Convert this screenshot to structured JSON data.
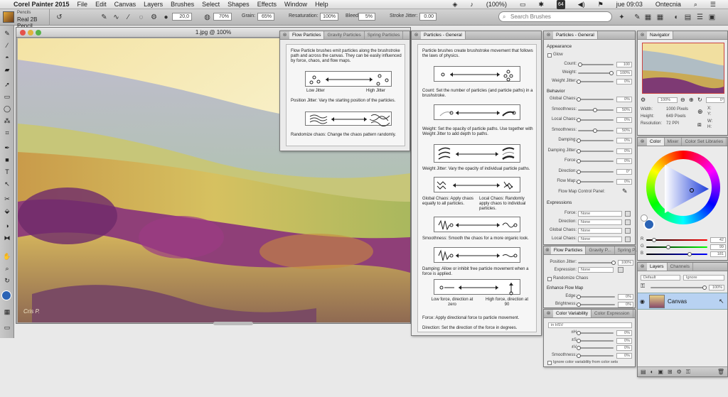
{
  "menubar": {
    "app": "Corel Painter 2015",
    "items": [
      "File",
      "Edit",
      "Canvas",
      "Layers",
      "Brushes",
      "Select",
      "Shapes",
      "Effects",
      "Window",
      "Help"
    ],
    "battery": "(100%)",
    "day_time": "jue 09:03",
    "user": "Ontecnia",
    "wifi_badge": "64"
  },
  "brush": {
    "category": "Pencils",
    "variant": "Real 2B Pencil"
  },
  "propbar": {
    "size": "20,0",
    "opacity": "70%",
    "grain_label": "Grain:",
    "grain": "65%",
    "resat_label": "Resaturation:",
    "resat": "100%",
    "bleed_label": "Bleed:",
    "bleed": "5%",
    "jitter_label": "Stroke Jitter:",
    "jitter": "0.00",
    "search_placeholder": "Search Brushes"
  },
  "canvas": {
    "title": "1.jpg @ 100%",
    "signature": "Cris P."
  },
  "flow_panel": {
    "tabs": [
      "Flow Particles",
      "Gravity Particles",
      "Spring Particles"
    ],
    "intro": "Flow Particle brushes emit particles along the brushstroke path and across the canvas. They can be easily influenced by force, chaos, and flow maps.",
    "low": "Low Jitter",
    "high": "High Jitter",
    "posjitter": "Position Jitter: Vary the starting position of the particles.",
    "randomize": "Randomize chaos: Change the chaos pattern randomly."
  },
  "general_help": {
    "tab": "Particles - General",
    "intro": "Particle brushes create brushstroke movement that follows the laws of physics.",
    "count": "Count: Set the number of particles (and particle paths) in a brushstroke.",
    "weight": "Weight: Set the opacity of particle paths. Use together with Weight Jitter to add depth to paths.",
    "wjitter": "Weight Jitter: Vary the opacity of individual particle paths.",
    "gchaos": "Global Chaos: Apply chaos equally to all particles.",
    "lchaos": "Local Chaos: Randomly apply chaos to individual particles.",
    "smooth": "Smoothness: Smooth the chaos for a more organic look.",
    "damping": "Damping: Allow or inhibit free particle movement when a force is applied.",
    "lowforce": "Low force, direction at zero",
    "highforce": "High force, direction at 90",
    "force": "Force: Apply directional force to particle movement.",
    "direction": "Direction: Set the direction of the force in degrees."
  },
  "gen_panel": {
    "tab": "Particles - General",
    "appearance": "Appearance",
    "glow": "Glow",
    "rows1": [
      {
        "label": "Count:",
        "value": "100"
      },
      {
        "label": "Weight:",
        "value": "100%"
      },
      {
        "label": "Weight Jitter:",
        "value": "0%"
      }
    ],
    "behavior": "Behavior",
    "rows2": [
      {
        "label": "Global Chaos:",
        "value": "0%"
      },
      {
        "label": "Smoothness:",
        "value": "50%"
      },
      {
        "label": "Local Chaos:",
        "value": "0%"
      },
      {
        "label": "Smoothness:",
        "value": "50%"
      },
      {
        "label": "Damping:",
        "value": "0%"
      },
      {
        "label": "Damping Jitter:",
        "value": "0%"
      },
      {
        "label": "Force:",
        "value": "0%"
      },
      {
        "label": "Direction:",
        "value": "0°"
      },
      {
        "label": "Flow Map:",
        "value": "0%"
      }
    ],
    "flowmap_panel": "Flow Map Control Panel:",
    "expressions": "Expressions",
    "rows3": [
      {
        "label": "Force:",
        "value": "None"
      },
      {
        "label": "Direction:",
        "value": "None"
      },
      {
        "label": "Global Chaos:",
        "value": "None"
      },
      {
        "label": "Local Chaos:",
        "value": "None"
      }
    ]
  },
  "flow_small": {
    "tabs": [
      "Flow Particles",
      "Gravity P...",
      "Spring P..."
    ],
    "posjitter": "Position Jitter:",
    "posjitter_v": "100%",
    "expression": "Expression:",
    "expression_v": "None",
    "randomize": "Randomize Chaos",
    "enhance": "Enhance Flow Map",
    "edge": "Edge:",
    "edge_v": "0%",
    "brightness": "Brightness:",
    "brightness_v": "0%"
  },
  "color_var": {
    "tabs": [
      "Color Variability",
      "Color Expression"
    ],
    "mode": "in HSV",
    "rows": [
      {
        "label": "±H",
        "value": "0%"
      },
      {
        "label": "±S",
        "value": "0%"
      },
      {
        "label": "±V",
        "value": "0%"
      },
      {
        "label": "Smoothness:",
        "value": "0%"
      }
    ],
    "ignore": "Ignore color variability from color sets"
  },
  "navigator": {
    "tab": "Navigator",
    "zoom": "100%",
    "rotation": "0°",
    "width": "Width:",
    "width_v": "1000 Pixels",
    "height": "Height:",
    "height_v": "649 Pixels",
    "res": "Resolution:",
    "res_v": "72 PPI",
    "x": "X:",
    "y": "Y:",
    "w": "W:",
    "h": "H:"
  },
  "color_panel": {
    "tabs": [
      "Color",
      "Mixer",
      "Color Set Libraries"
    ],
    "r": "R",
    "g": "G",
    "b": "B",
    "r_v": "42",
    "g_v": "99",
    "b_v": "181",
    "main": "#2a63b5"
  },
  "layers": {
    "tabs": [
      "Layers",
      "Channels"
    ],
    "composite": "Default",
    "method": "Ignore",
    "opacity": "100%",
    "layer": "Canvas"
  }
}
